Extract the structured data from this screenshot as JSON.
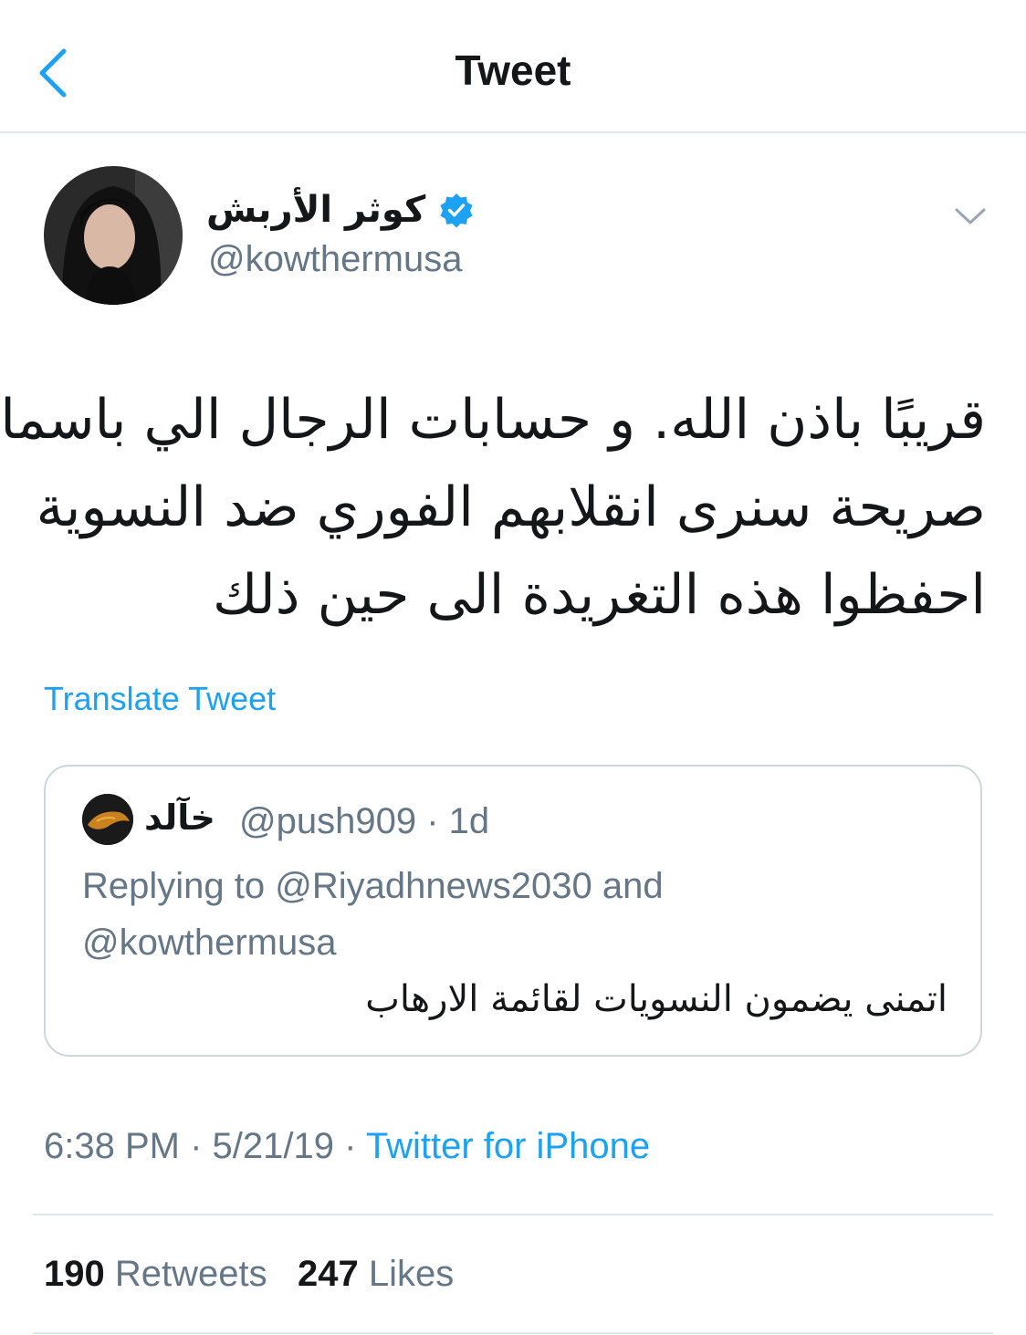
{
  "nav": {
    "title": "Tweet"
  },
  "author": {
    "display_name": "كوثر الأربش",
    "handle": "@kowthermusa",
    "verified": true
  },
  "tweet": {
    "lines": [
      "قريبًا باذن الله. و حسابات الرجال الي باسماء",
      "صريحة  سنرى انقلابهم الفوري ضد النسوية",
      "احفظوا هذه التغريدة الى حين ذلك"
    ],
    "translate_label": "Translate Tweet"
  },
  "quote": {
    "name": "خآلد",
    "handle": "@push909",
    "separator": "·",
    "age": "1d",
    "replying_line1": "Replying to @Riyadhnews2030 and",
    "replying_line2": "@kowthermusa",
    "text": "اتمنى يضمون النسويات لقائمة الارهاب"
  },
  "meta": {
    "time": "6:38 PM",
    "date": "5/21/19",
    "separator": "·",
    "source": "Twitter for iPhone"
  },
  "stats": {
    "retweets_count": "190",
    "retweets_label": "Retweets",
    "likes_count": "247",
    "likes_label": "Likes"
  },
  "colors": {
    "accent": "#1da1f2",
    "text": "#14171a",
    "secondary": "#657786",
    "border": "#e1e8ed"
  }
}
